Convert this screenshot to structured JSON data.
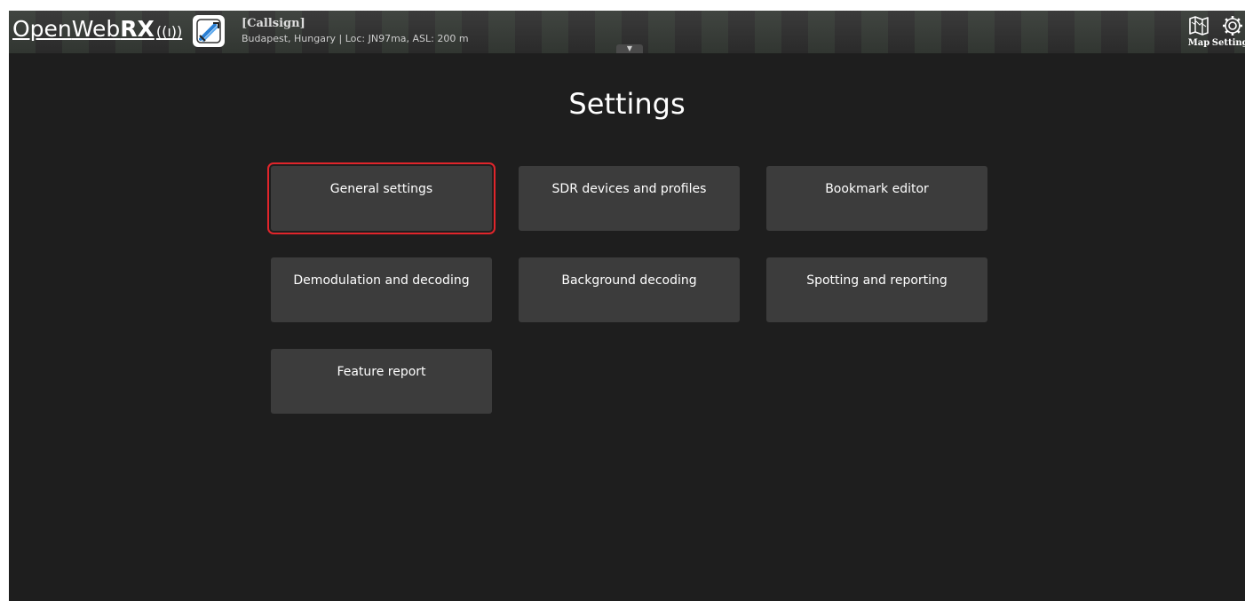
{
  "header": {
    "logo_text_open": "Open",
    "logo_text_web": "Web",
    "logo_text_rx": "RX",
    "logo_antenna": "((ı))",
    "receiver_name": "[Callsign]",
    "receiver_location": "Budapest, Hungary | Loc: JN97ma, ASL: 200 m",
    "nav": [
      {
        "label": "Map",
        "icon": "map-icon"
      },
      {
        "label": "Settings",
        "icon": "gear-icon"
      }
    ]
  },
  "page": {
    "title": "Settings"
  },
  "settings_buttons": [
    {
      "label": "General settings",
      "focused": true
    },
    {
      "label": "SDR devices and profiles"
    },
    {
      "label": "Bookmark editor"
    },
    {
      "label": "Demodulation and decoding"
    },
    {
      "label": "Background decoding"
    },
    {
      "label": "Spotting and reporting"
    },
    {
      "label": "Feature report"
    }
  ],
  "colors": {
    "background": "#1e1e1e",
    "button": "#3c3c3c",
    "focus_outline": "#e0252b"
  }
}
